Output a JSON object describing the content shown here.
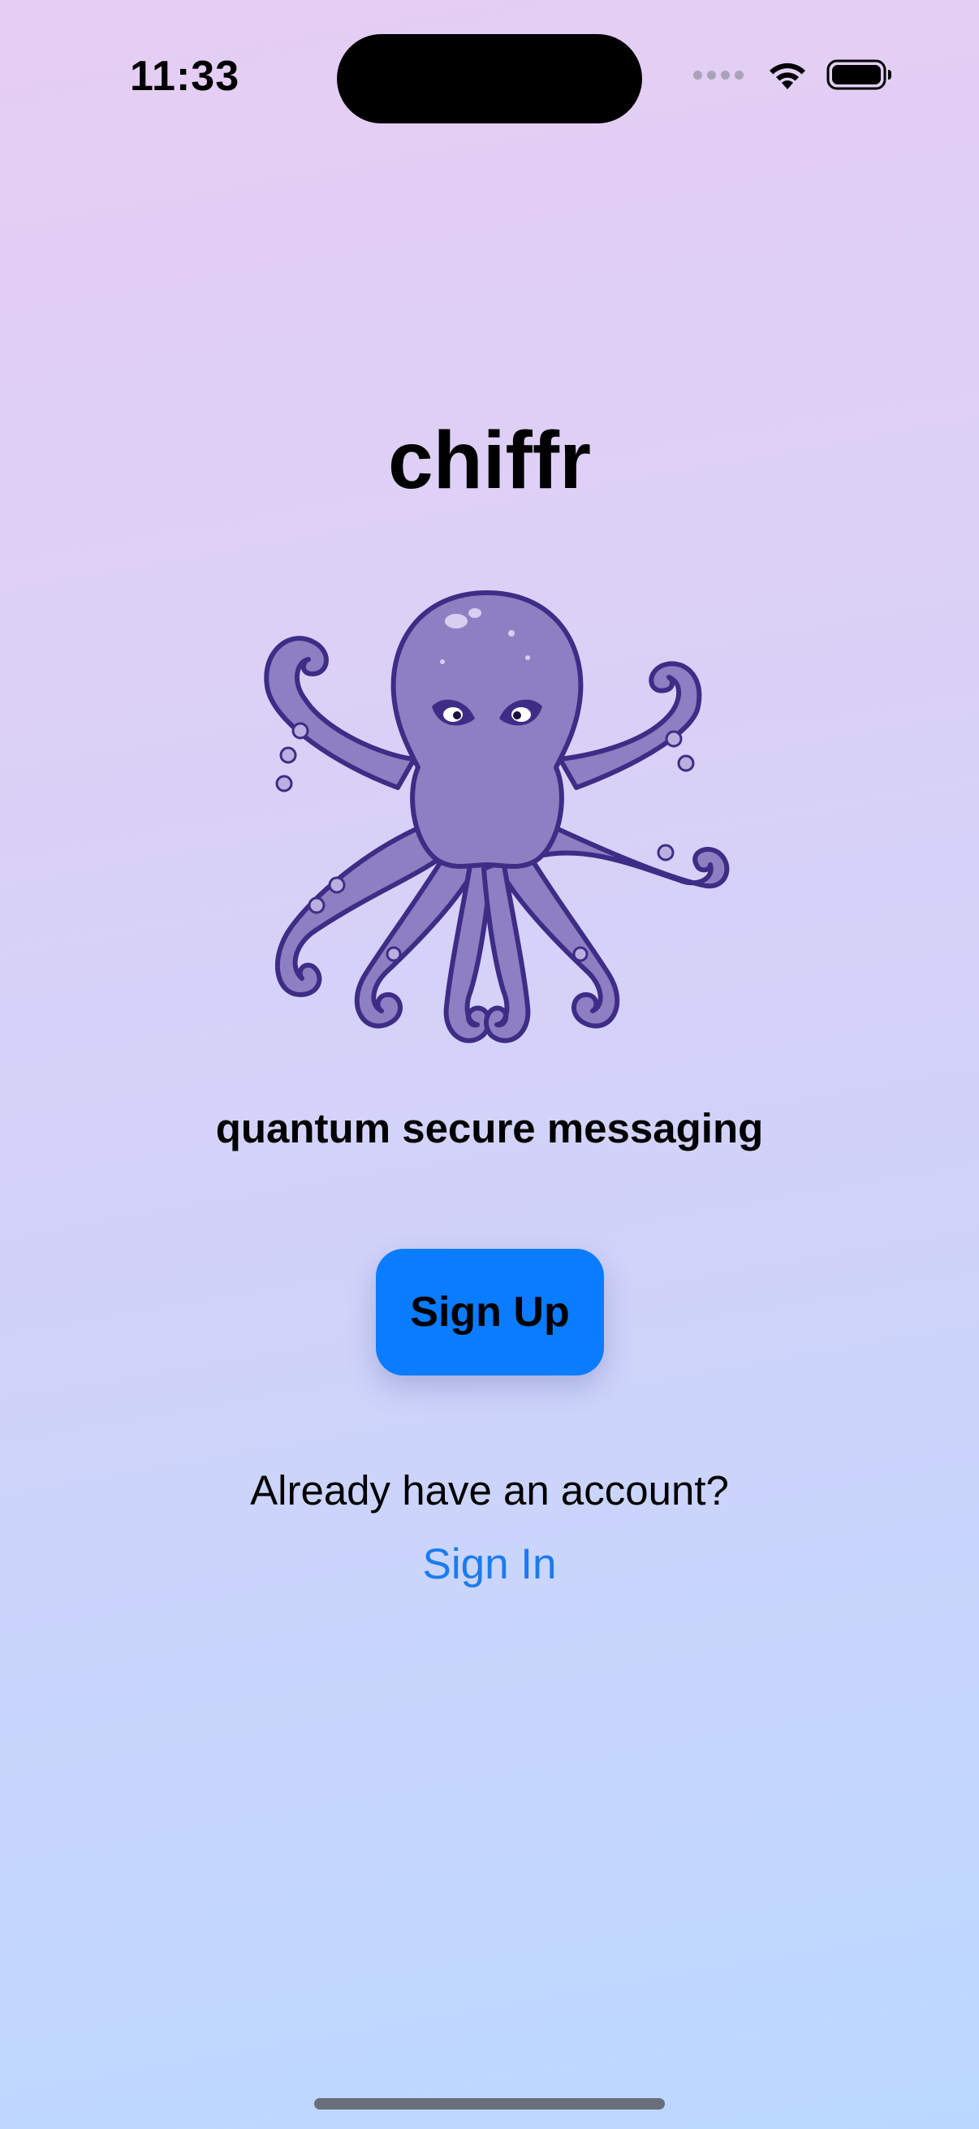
{
  "status_bar": {
    "time": "11:33",
    "icons": [
      "cellular-signal-icon",
      "wifi-icon",
      "battery-icon"
    ]
  },
  "app": {
    "title": "chiffr",
    "logo": "octopus-logo",
    "tagline": "quantum secure messaging"
  },
  "actions": {
    "sign_up_label": "Sign Up",
    "account_prompt": "Already have an account?",
    "sign_in_label": "Sign In"
  },
  "colors": {
    "accent": "#0a7cff",
    "link": "#1a7cf0",
    "octopus": "#8c80c2",
    "octopus_outline": "#3e2d86"
  }
}
